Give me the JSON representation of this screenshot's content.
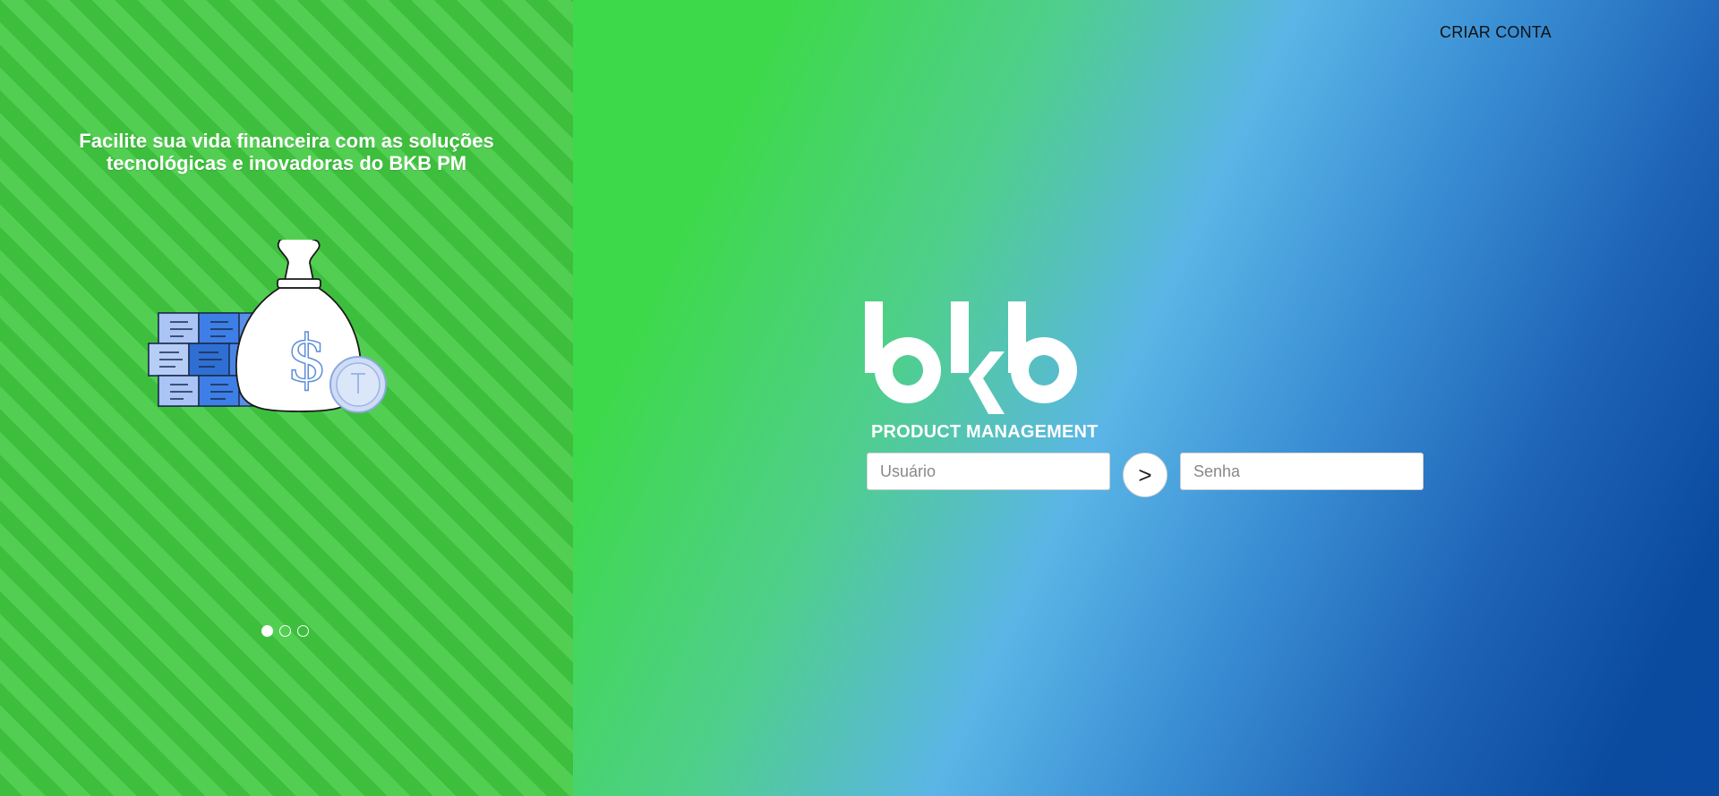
{
  "promo": {
    "tagline_line1": "Facilite sua vida financeira com as soluções",
    "tagline_line2": "tecnológicas e inovadoras do BKB PM",
    "illustration_icon": "money-bag-with-cash-stacks",
    "carousel": {
      "slide_count": 3,
      "active_index": 0
    }
  },
  "header": {
    "create_account_label": "CRIAR CONTA"
  },
  "login": {
    "logo_text": "bkb",
    "logo_subtitle": "PRODUCT MANAGEMENT",
    "username": {
      "value": "",
      "placeholder": "Usuário"
    },
    "password": {
      "value": "",
      "placeholder": "Senha"
    },
    "submit_label": ">"
  },
  "colors": {
    "left_stripe_dark": "#3dbf3d",
    "left_stripe_light": "#52cf52",
    "gradient_green": "#3ed94a",
    "gradient_sky": "#5bb5e6",
    "gradient_navy": "#0a4aa0",
    "bills_blue": "#3d7fe6"
  }
}
